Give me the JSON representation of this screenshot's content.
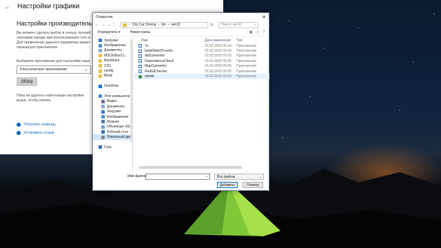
{
  "settings": {
    "title": "Настройки графики",
    "subtitle": "Настройки производительност",
    "paragraph": [
      "Вы можете сделать выбор в пользу лучшей",
      "экономии заряда при использовании того и",
      "Для применения данного параметра может",
      "перезапуск приложения."
    ],
    "select_prompt": "Выберите приложение для настройки пара",
    "select_value": "Классическое приложение",
    "browse_label": "Обзор",
    "empty_text": [
      "Пока не удалось найти ваши настройки",
      "выше, чтобы начать."
    ],
    "help_link": "Получить помощь",
    "feedback_link": "Отправить отзыв"
  },
  "dialog": {
    "title": "Открытие",
    "close_glyph": "✕",
    "breadcrumb": [
      "City Car Driving",
      "bin",
      "win32"
    ],
    "search_placeholder": "Поиск: win32",
    "toolbar": {
      "organize": "Упорядочить ▾",
      "new_folder": "Новая папка"
    },
    "columns": [
      "Имя",
      "Дата изменения",
      "Тип"
    ],
    "files": [
      {
        "name": "7z",
        "date": "23.02.2020 05:04",
        "type": "Приложение",
        "icon": "exe-icon"
      },
      {
        "name": "buildStaticPLevels",
        "date": "23.02.2020 05:04",
        "type": "Приложение",
        "icon": "exe-icon"
      },
      {
        "name": "db3converter",
        "date": "23.02.2020 05:05",
        "type": "Приложение",
        "icon": "exe-icon"
      },
      {
        "name": "DependencyCheck",
        "date": "23.02.2020 05:05",
        "type": "Приложение",
        "icon": "exe-icon"
      },
      {
        "name": "MapConverter",
        "date": "23.02.2020 05:05",
        "type": "Приложение",
        "icon": "exe-icon"
      },
      {
        "name": "RedistChecker",
        "date": "23.02.2020 05:05",
        "type": "Приложение",
        "icon": "exe-icon"
      },
      {
        "name": "starter",
        "date": "23.02.2020 05:04",
        "type": "Приложение",
        "icon": "starter-icon"
      }
    ],
    "nav": [
      {
        "label": "Загрузки",
        "icon": "download-icon",
        "color": "#3a7bd5"
      },
      {
        "label": "Изображения",
        "icon": "pictures-icon",
        "color": "#4a90d9"
      },
      {
        "label": "Документы",
        "icon": "documents-icon",
        "color": "#8aa8c8"
      },
      {
        "label": "MSCEditor11...",
        "icon": "folder-icon",
        "color": "#e8c14a"
      },
      {
        "label": "Bandicam",
        "icon": "folder-icon",
        "color": "#e8c14a"
      },
      {
        "label": "CD1",
        "icon": "folder-icon",
        "color": "#e8c14a"
      },
      {
        "label": "config",
        "icon": "folder-icon",
        "color": "#e8c14a"
      },
      {
        "label": "Mods",
        "icon": "folder-icon",
        "color": "#e8c14a"
      },
      {
        "label": "",
        "icon": "",
        "color": ""
      },
      {
        "label": "OneDrive",
        "icon": "onedrive-icon",
        "color": "#1e6fd9"
      },
      {
        "label": "",
        "icon": "",
        "color": ""
      },
      {
        "label": "Этот компьютер",
        "icon": "computer-icon",
        "color": "#4a90d9"
      },
      {
        "label": "Видео",
        "icon": "video-icon",
        "color": "#6a6a9a"
      },
      {
        "label": "Документы",
        "icon": "documents-icon",
        "color": "#8aa8c8"
      },
      {
        "label": "Загрузки",
        "icon": "download-icon",
        "color": "#3a7bd5"
      },
      {
        "label": "Изображения",
        "icon": "pictures-icon",
        "color": "#4a90d9"
      },
      {
        "label": "Музыка",
        "icon": "music-icon",
        "color": "#4a7ab0"
      },
      {
        "label": "Объемные объ",
        "icon": "3d-objects-icon",
        "color": "#6aa0d0"
      },
      {
        "label": "Рабочий стол",
        "icon": "desktop-icon",
        "color": "#3a6fb0"
      },
      {
        "label": "Локальный дис",
        "icon": "drive-icon",
        "color": "#888888",
        "selected": true
      },
      {
        "label": "",
        "icon": "",
        "color": ""
      },
      {
        "label": "Сеть",
        "icon": "network-icon",
        "color": "#3a6fb0"
      }
    ],
    "filename_label": "Имя файла:",
    "filename_value": "",
    "filter_value": "Все файлы",
    "add_button": "Добавить",
    "cancel_button": "Отмена"
  }
}
